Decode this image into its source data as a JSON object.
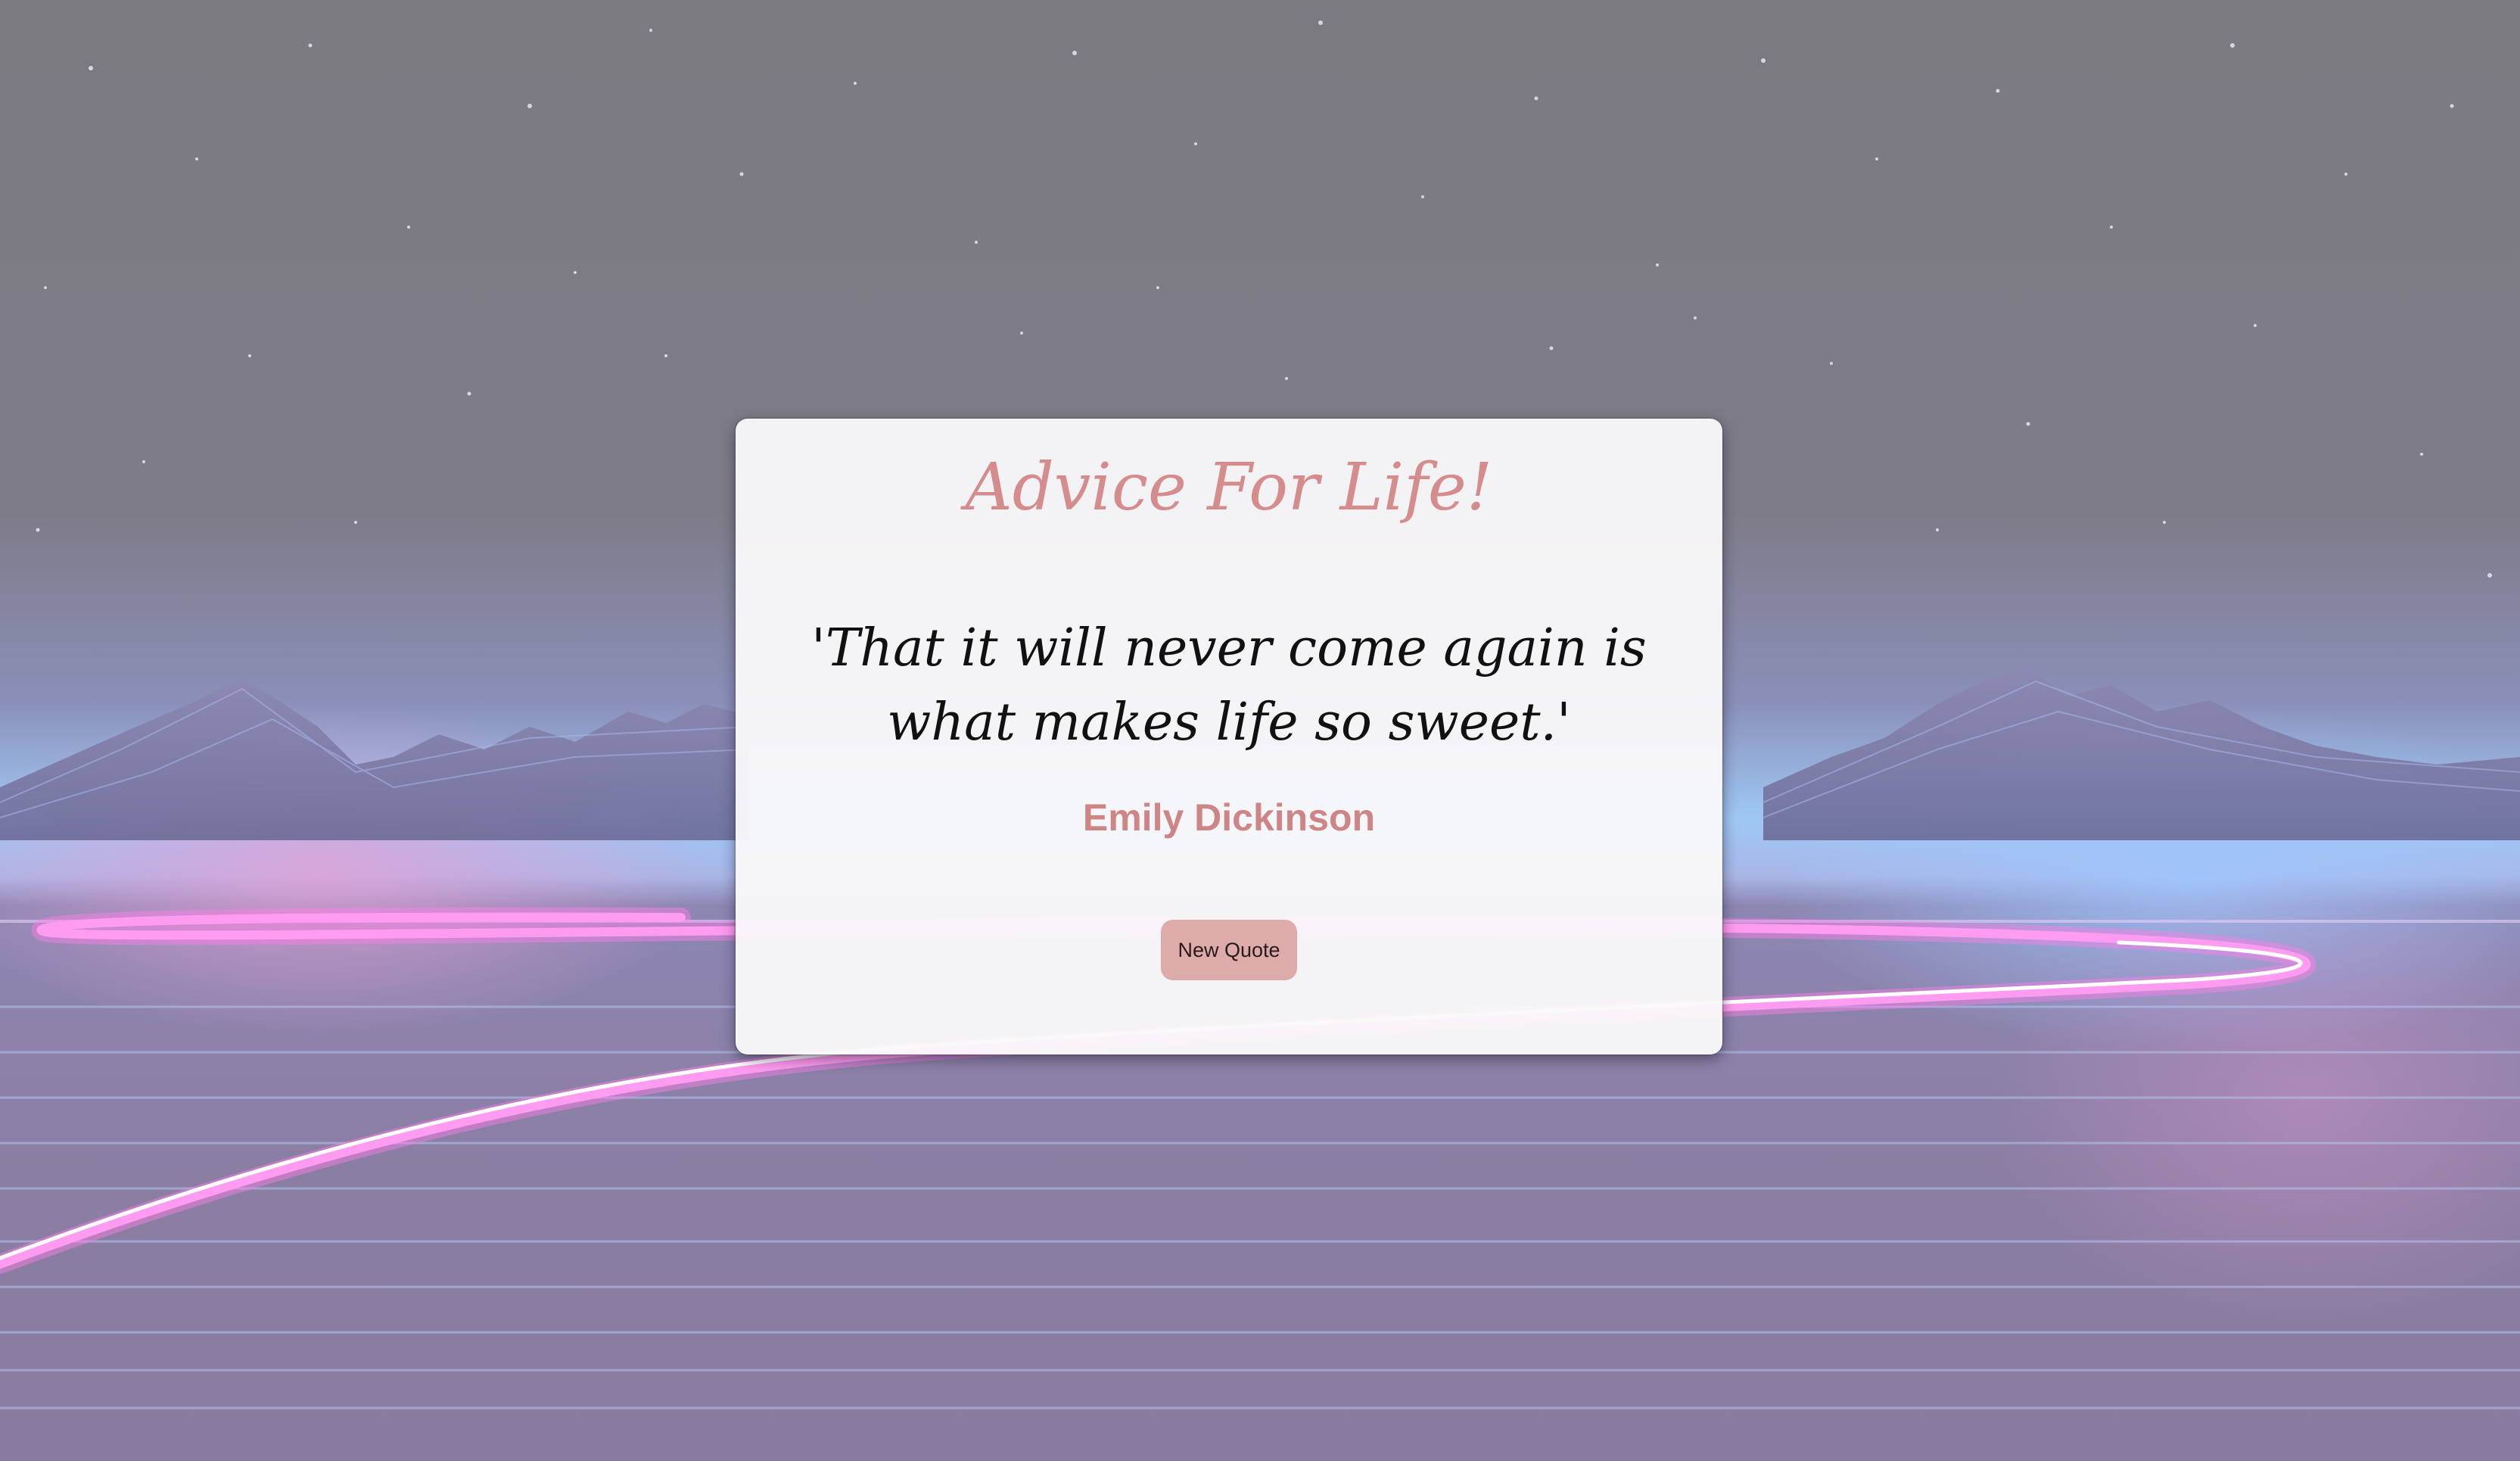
{
  "app": {
    "title": "Advice For Life!"
  },
  "quote": {
    "text": "'That it will never come again is what makes life so sweet.'",
    "author": "Emily Dickinson"
  },
  "actions": {
    "new_quote_label": "New Quote"
  },
  "colors": {
    "accent": "#d58c8c",
    "button_bg": "#deabab",
    "card_bg": "#faf9fa",
    "sky": "#7d7b85",
    "neon_pink": "#ff7ee8",
    "horizon_blue": "#9ec8f5"
  },
  "background": {
    "scene": "synthwave-night-landscape"
  }
}
